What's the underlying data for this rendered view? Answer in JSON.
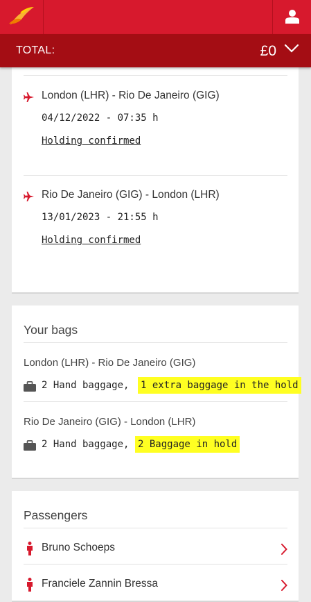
{
  "header": {
    "total_label": "TOTAL:",
    "total_value": "£0",
    "brand_color": "#d7192d",
    "total_bar_color": "#a40d14"
  },
  "flights": [
    {
      "route": "London (LHR) - Rio De Janeiro (GIG)",
      "datetime": "04/12/2022 - 07:35 h",
      "status": "Holding confirmed"
    },
    {
      "route": "Rio De Janeiro (GIG) - London (LHR)",
      "datetime": "13/01/2023 - 21:55 h",
      "status": "Holding confirmed"
    }
  ],
  "bags": {
    "title": "Your bags",
    "items": [
      {
        "route": "London (LHR) - Rio De Janeiro (GIG)",
        "hand": "2 Hand baggage,",
        "hold": "1 extra baggage in the hold"
      },
      {
        "route": "Rio De Janeiro (GIG) - London (LHR)",
        "hand": "2 Hand baggage,",
        "hold": "2 Baggage in hold"
      }
    ],
    "highlight_color": "#ffff22"
  },
  "passengers": {
    "title": "Passengers",
    "list": [
      {
        "name": "Bruno Schoeps"
      },
      {
        "name": "Franciele Zannin Bressa"
      }
    ]
  },
  "icons": [
    "airline-logo-icon",
    "user-icon",
    "chevron-down-icon",
    "plane-icon",
    "suitcase-icon",
    "person-icon",
    "chevron-right-icon"
  ]
}
